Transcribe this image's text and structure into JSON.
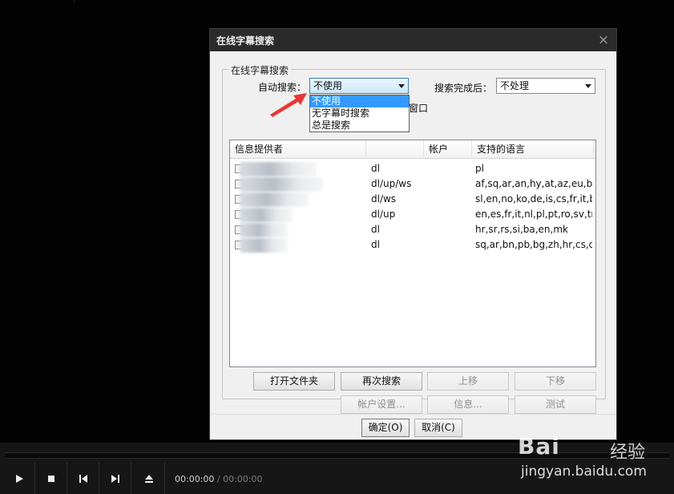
{
  "dialog": {
    "title": "在线字幕搜索",
    "close_glyph": "×",
    "group_legend": "在线字幕搜索",
    "auto_search_label": "自动搜索：",
    "auto_search_value": "不使用",
    "after_search_label": "搜索完成后：",
    "after_search_value": "不处理",
    "hidden_text_fragment": "窗口",
    "dropdown_options": [
      "不使用",
      "无字幕时搜索",
      "总是搜索"
    ],
    "columns": [
      "信息提供者",
      "",
      "帐户",
      "支持的语言"
    ],
    "rows": [
      {
        "col2": "dl",
        "languages": "pl"
      },
      {
        "col2": "dl/up/ws",
        "languages": "af,sq,ar,an,hy,at,az,eu,be..."
      },
      {
        "col2": "dl/ws",
        "languages": "sl,en,no,ko,de,is,cs,fr,it,b..."
      },
      {
        "col2": "dl/up",
        "languages": "en,es,fr,it,nl,pl,pt,ro,sv,tr"
      },
      {
        "col2": "dl",
        "languages": "hr,sr,rs,si,ba,en,mk"
      },
      {
        "col2": "dl",
        "languages": "sq,ar,bn,pb,bg,zh,hr,cs,d..."
      }
    ],
    "buttons": {
      "open_folder": "打开文件夹",
      "search_again": "再次搜索",
      "move_up": "上移",
      "move_down": "下移",
      "account_settings": "帐户设置...",
      "info": "信息...",
      "test": "测试",
      "ok": "确定(O)",
      "cancel": "取消(C)"
    }
  },
  "player": {
    "time_current": "00:00:00",
    "time_separator": "/",
    "time_duration": "00:00:00",
    "icons": [
      "play-icon",
      "stop-icon",
      "previous-icon",
      "next-icon",
      "eject-icon"
    ]
  },
  "watermark": {
    "brand": "Bai",
    "brand_suffix": "经验",
    "url": "jingyan.baidu.com"
  },
  "colors": {
    "titlebar": "#2b2b2b",
    "selection": "#3399ff",
    "arrow": "#e53935"
  }
}
